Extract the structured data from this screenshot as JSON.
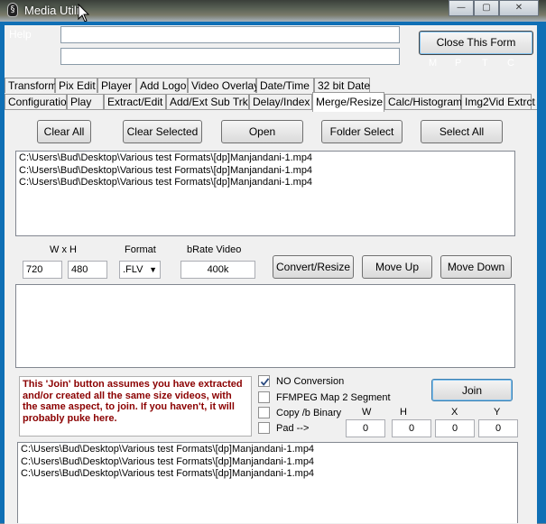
{
  "window": {
    "title": "Media Utilit",
    "icon_glyph": "§",
    "controls": {
      "minimize": "—",
      "maximize": "▢",
      "close": "✕"
    }
  },
  "menu": {
    "help": "Help"
  },
  "top_fields": {
    "field1": "",
    "field2": ""
  },
  "close_form_label": "Close This Form",
  "mptc": [
    "M",
    "P",
    "T",
    "C"
  ],
  "tabs_row1": [
    "Transform",
    "Pix Edit",
    "Player",
    "Add Logo",
    "Video Overlay",
    "Date/Time",
    "32 bit Date"
  ],
  "tabs_row2": [
    "Configuration",
    "Play",
    "Extract/Edit",
    "Add/Ext Sub Trk",
    "Delay/Index",
    "Merge/Resize",
    "Calc/Histogram",
    "Img2Vid Extrct"
  ],
  "active_tab": "Merge/Resize",
  "buttons": {
    "clear_all": "Clear All",
    "clear_selected": "Clear Selected",
    "open": "Open",
    "folder_select": "Folder Select",
    "select_all": "Select All",
    "convert_resize": "Convert/Resize",
    "move_up": "Move Up",
    "move_down": "Move Down",
    "join": "Join"
  },
  "file_list1": [
    "C:\\Users\\Bud\\Desktop\\Various test Formats\\[dp]Manjandani-1.mp4",
    "C:\\Users\\Bud\\Desktop\\Various test Formats\\[dp]Manjandani-1.mp4",
    "C:\\Users\\Bud\\Desktop\\Various test Formats\\[dp]Manjandani-1.mp4"
  ],
  "resize": {
    "wxh_label": "W x H",
    "width": "720",
    "height": "480",
    "format_label": "Format",
    "format_value": ".FLV",
    "brate_label": "bRate Video",
    "brate_value": "400k"
  },
  "join_note": "This 'Join' button assumes you have extracted  and/or created all the same size videos, with the same aspect,  to join.  If you haven't, it will probably puke here.",
  "options": {
    "no_conversion": {
      "label": "NO Conversion",
      "checked": true
    },
    "ffmpeg_map": {
      "label": "FFMPEG Map 2 Segment",
      "checked": false
    },
    "copy_binary": {
      "label": "Copy /b Binary",
      "checked": false
    },
    "pad": {
      "label": "Pad  -->",
      "checked": false
    }
  },
  "pad_fields": {
    "w_label": "W",
    "w": "0",
    "h_label": "H",
    "h": "0",
    "x_label": "X",
    "x": "0",
    "y_label": "Y",
    "y": "0"
  },
  "file_list2": [
    "C:\\Users\\Bud\\Desktop\\Various test Formats\\[dp]Manjandani-1.mp4",
    "C:\\Users\\Bud\\Desktop\\Various test Formats\\[dp]Manjandani-1.mp4",
    "C:\\Users\\Bud\\Desktop\\Various test Formats\\[dp]Manjandani-1.mp4"
  ],
  "colors": {
    "frame": "#0f6fb5",
    "note_text": "#8b0000"
  }
}
